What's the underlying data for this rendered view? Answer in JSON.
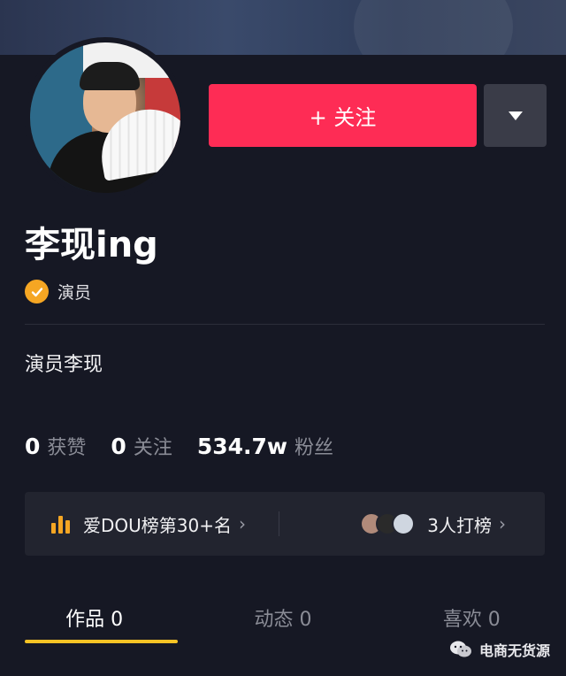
{
  "profile": {
    "name": "李现ing",
    "verification": "演员",
    "bio": "演员李现"
  },
  "actions": {
    "follow_label": "+ 关注"
  },
  "stats": [
    {
      "num": "0",
      "label": "获赞"
    },
    {
      "num": "0",
      "label": "关注"
    },
    {
      "num": "534.7w",
      "label": "粉丝"
    }
  ],
  "ranking": {
    "left_text": "爱DOU榜第30+名",
    "right_text": "3人打榜"
  },
  "tabs": [
    {
      "label": "作品 0"
    },
    {
      "label": "动态 0"
    },
    {
      "label": "喜欢 0"
    }
  ],
  "watermark": {
    "text": "电商无货源"
  },
  "colors": {
    "background": "#161824",
    "follow_button": "#fe2c55",
    "accent": "#f5a623",
    "tab_underline": "#f7c325"
  }
}
